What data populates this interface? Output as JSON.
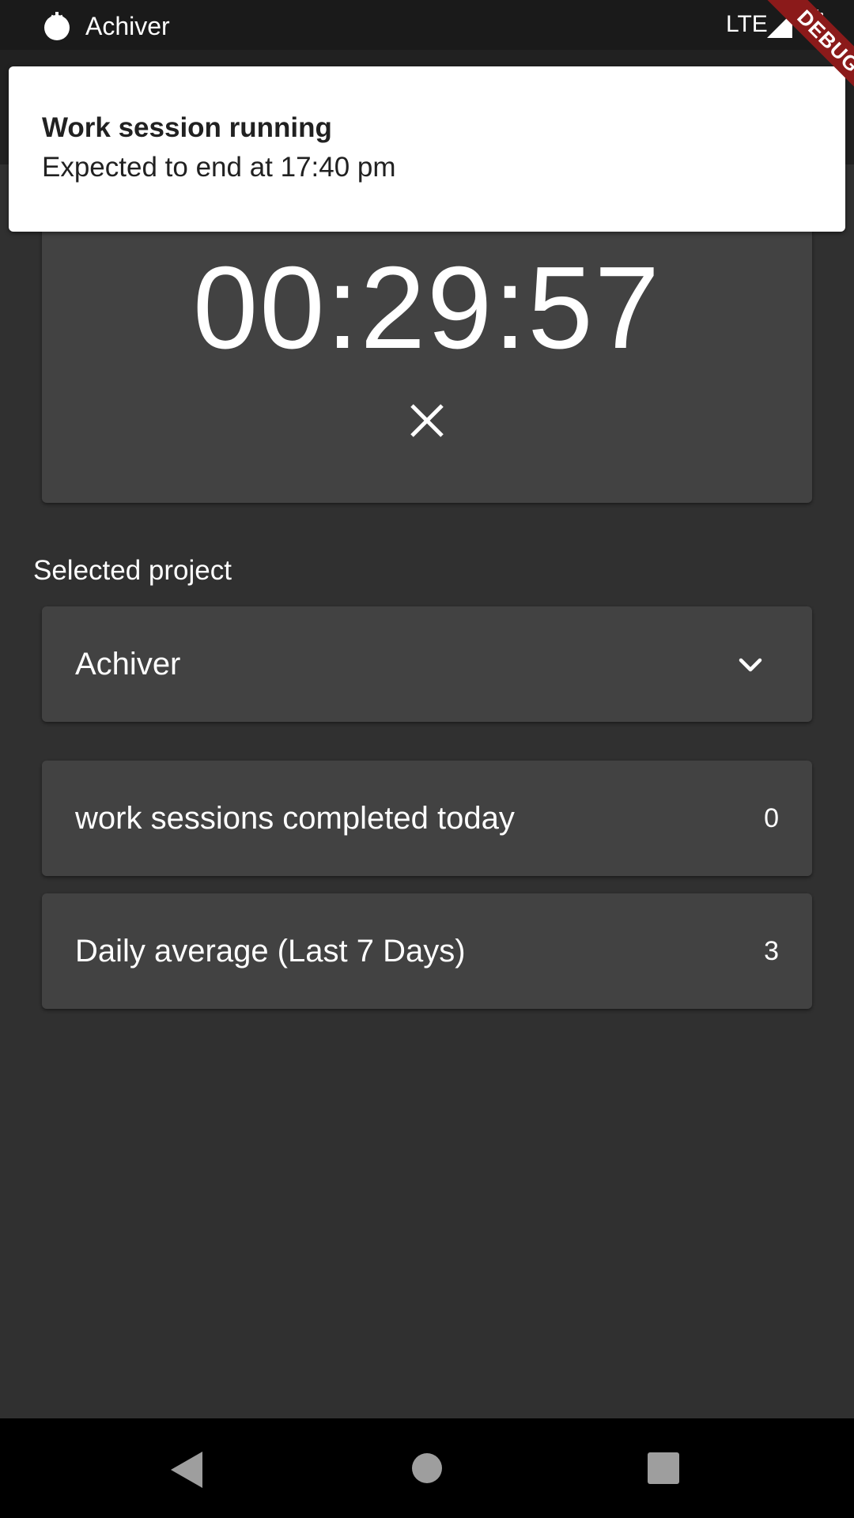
{
  "status_bar": {
    "app_name": "Achiver",
    "app_icon": "tomato-icon",
    "network": "LTE",
    "signal_icon": "cell-signal-icon",
    "battery_icon": "battery-icon"
  },
  "debug_banner": {
    "label": "DEBUG"
  },
  "notification": {
    "title": "Work session running",
    "body": "Expected to end at 17:40 pm"
  },
  "timer": {
    "time": "00:29:57",
    "cancel_icon": "close-icon"
  },
  "project": {
    "section_label": "Selected project",
    "selected": "Achiver",
    "dropdown_icon": "chevron-down-icon"
  },
  "stats": [
    {
      "label": "work sessions completed today",
      "value": "0"
    },
    {
      "label": "Daily average (Last 7 Days)",
      "value": "3"
    }
  ],
  "nav_bar": {
    "back_icon": "back-triangle-icon",
    "home_icon": "home-circle-icon",
    "recents_icon": "recents-square-icon"
  },
  "colors": {
    "background": "#303030",
    "card": "#424242",
    "status_bar": "#1a1a1a",
    "notification_bg": "#ffffff",
    "debug_banner": "#8b1a1a"
  }
}
